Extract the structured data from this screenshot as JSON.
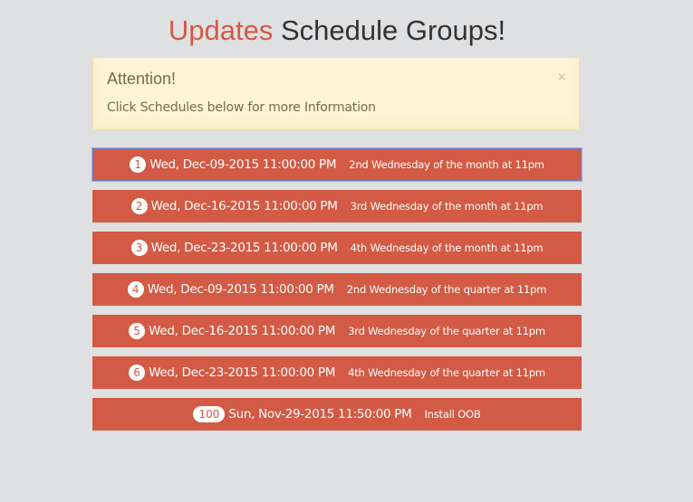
{
  "header": {
    "title_accent": "Updates",
    "title_rest": " Schedule Groups!"
  },
  "alert": {
    "heading": "Attention!",
    "message": "Click Schedules below for more Information",
    "close_glyph": "×"
  },
  "schedules": [
    {
      "badge": "1",
      "date": "Wed, Dec-09-2015 11:00:00 PM",
      "description": "2nd Wednesday of the month at 11pm"
    },
    {
      "badge": "2",
      "date": "Wed, Dec-16-2015 11:00:00 PM",
      "description": "3rd Wednesday of the month at 11pm"
    },
    {
      "badge": "3",
      "date": "Wed, Dec-23-2015 11:00:00 PM",
      "description": "4th Wednesday of the month at 11pm"
    },
    {
      "badge": "4",
      "date": "Wed, Dec-09-2015 11:00:00 PM",
      "description": "2nd Wednesday of the quarter at 11pm"
    },
    {
      "badge": "5",
      "date": "Wed, Dec-16-2015 11:00:00 PM",
      "description": "3rd Wednesday of the quarter at 11pm"
    },
    {
      "badge": "6",
      "date": "Wed, Dec-23-2015 11:00:00 PM",
      "description": "4th Wednesday of the quarter at 11pm"
    },
    {
      "badge": "100",
      "date": "Sun, Nov-29-2015 11:50:00 PM",
      "description": "Install OOB"
    }
  ],
  "colors": {
    "accent": "#d35a44",
    "background": "#dfe0e2",
    "alert_background": "#fcf4d5",
    "alert_text": "#7a6a4b",
    "active_border": "#6f7fc7"
  }
}
